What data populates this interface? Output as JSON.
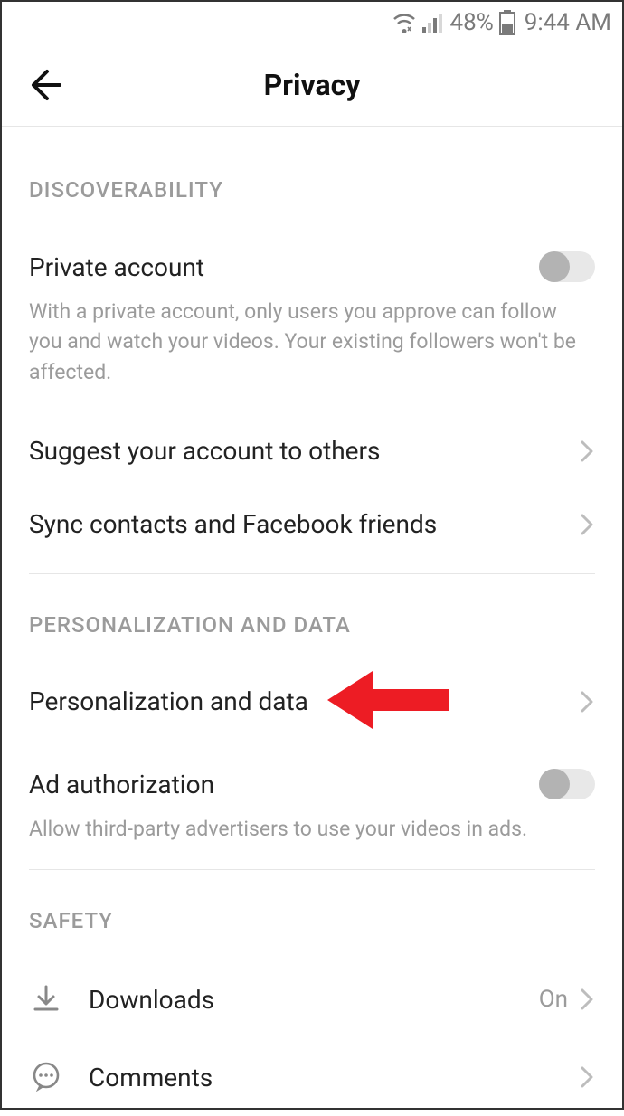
{
  "status_bar": {
    "battery_pct": "48%",
    "time": "9:44 AM"
  },
  "header": {
    "title": "Privacy"
  },
  "sections": {
    "discoverability": {
      "title": "DISCOVERABILITY",
      "private_account": {
        "label": "Private account",
        "desc": "With a private account, only users you approve can follow you and watch your videos. Your existing followers won't be affected."
      },
      "suggest": {
        "label": "Suggest your account to others"
      },
      "sync": {
        "label": "Sync contacts and Facebook friends"
      }
    },
    "personalization": {
      "title": "PERSONALIZATION AND DATA",
      "pdata": {
        "label": "Personalization and data"
      },
      "ad_auth": {
        "label": "Ad authorization",
        "desc": "Allow third-party advertisers to use your videos in ads."
      }
    },
    "safety": {
      "title": "SAFETY",
      "downloads": {
        "label": "Downloads",
        "value": "On"
      },
      "comments": {
        "label": "Comments"
      }
    }
  }
}
